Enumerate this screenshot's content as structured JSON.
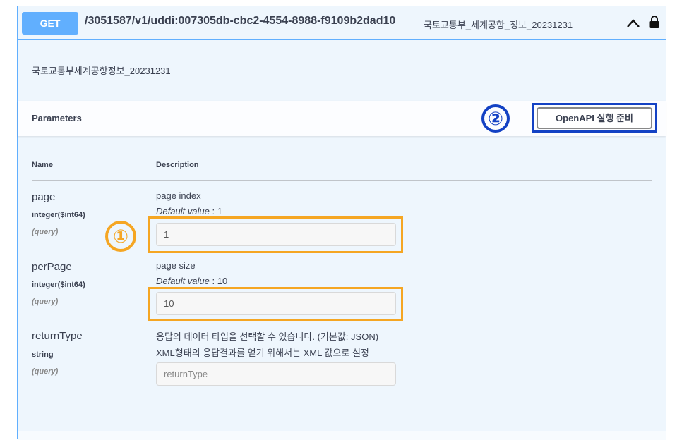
{
  "operation": {
    "method": "GET",
    "path": "/3051587/v1/uddi:007305db-cbc2-4554-8988-f9109b2dad10",
    "summary": "국토교통부_세계공항_정보_20231231",
    "description": "국토교통부세계공항정보_20231231",
    "icons": [
      "chevron-up-icon",
      "lock-icon"
    ]
  },
  "parameters": {
    "title": "Parameters",
    "try_button": "OpenAPI 실행 준비",
    "columns": {
      "name": "Name",
      "description": "Description"
    },
    "items": [
      {
        "name": "page",
        "type": "integer($int64)",
        "in": "(query)",
        "description": "page index",
        "default_label": "Default value",
        "default_value": ": 1",
        "value": "1",
        "placeholder": ""
      },
      {
        "name": "perPage",
        "type": "integer($int64)",
        "in": "(query)",
        "description": "page size",
        "default_label": "Default value",
        "default_value": ": 10",
        "value": "10",
        "placeholder": ""
      },
      {
        "name": "returnType",
        "type": "string",
        "in": "(query)",
        "description": "응답의 데이터 타입을 선택할 수 있습니다. (기본값: JSON)",
        "description2": "XML형태의 응답결과를 얻기 위해서는 XML 값으로 설정",
        "value": "",
        "placeholder": "returnType"
      }
    ]
  },
  "annotations": {
    "badge_1": "①",
    "badge_2": "②",
    "colors": {
      "badge_1": "#f5a623",
      "badge_2": "#1442c4",
      "method": "#61affe"
    }
  }
}
